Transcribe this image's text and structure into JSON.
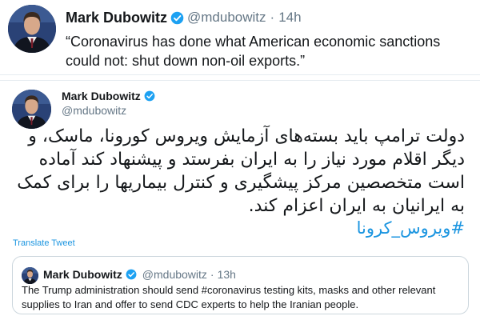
{
  "top_tweet": {
    "author_name": "Mark Dubowitz",
    "handle": "@mdubowitz",
    "separator": "·",
    "time": "14h",
    "text": "“Coronavirus has done what American economic sanctions could not: shut down non-oil exports.”"
  },
  "main_tweet": {
    "author_name": "Mark Dubowitz",
    "handle": "@mdubowitz",
    "text": "دولت ترامپ باید بسته‌های آزمایش ویروس کورونا، ماسک، و دیگر اقلام مورد نیاز را به ایران بفرستد و پیشنهاد کند آماده است متخصصین مرکز پیشگیری و کنترل بیماریها را برای کمک به ایرانیان به ایران اعزام کند.",
    "hashtag": "#ویروس_کرونا",
    "translate_label": "Translate Tweet"
  },
  "quoted_tweet": {
    "author_name": "Mark Dubowitz",
    "handle": "@mdubowitz",
    "separator": "·",
    "time": "13h",
    "text": "The Trump administration should send #coronavirus testing kits, masks and other relevant supplies to Iran and offer to send CDC experts to help the Iranian people."
  },
  "icons": {
    "verified": "verified-badge-icon",
    "avatar": "profile-avatar"
  },
  "colors": {
    "link_blue": "#1b95e0",
    "verified_blue": "#1da1f2",
    "secondary_text": "#657786",
    "primary_text": "#14171a",
    "border": "#ccd6dd"
  }
}
